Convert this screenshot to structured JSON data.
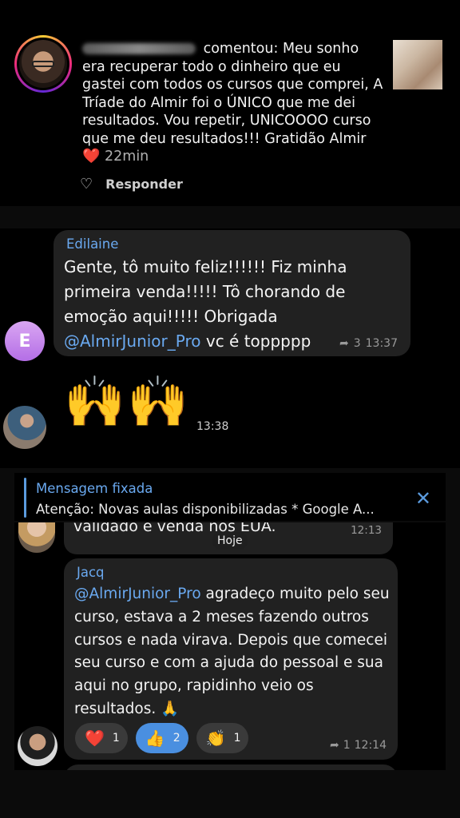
{
  "instagram": {
    "comment_prefix": "comentou:",
    "comment_text": "Meu sonho era recuperar todo o dinheiro que eu gastei com todos os cursos que comprei, A Tríade do Almir foi o ÚNICO que me dei resultados. Vou repetir, UNICOOOO curso que me deu resultados!!! Gratidão Almir",
    "heart_emoji": "❤️",
    "time": "22min",
    "reply_label": "Responder",
    "like_icon": "heart-outline-icon"
  },
  "chat1": {
    "sender": "Edilaine",
    "message_text": "Gente, tô muito feliz!!!!!! Fiz minha primeira venda!!!!! Tô chorando de emoção aqui!!!!! Obrigada ",
    "mention": "@AlmirJunior_Pro",
    "message_suffix": " vc é toppppp",
    "reply_count": "3",
    "time": "13:37",
    "avatar_letter": "E",
    "emoji_message": "🙌🙌",
    "emoji_time": "13:38"
  },
  "chat2": {
    "pinned_title": "Mensagem fixada",
    "pinned_text": "Atenção: Novas aulas disponibilizadas * Google A...",
    "close_icon": "✕",
    "prev_message": "validado e venda nos EUA.",
    "prev_time": "12:13",
    "date_chip": "Hoje",
    "sender": "Jacq",
    "mention": "@AlmirJunior_Pro",
    "message_text": " agradeço muito pelo seu curso, estava a 2 meses fazendo outros cursos e nada virava. Depois que comecei seu curso e com a ajuda do pessoal e sua aqui no grupo, rapidinho veio os resultados. 🙏",
    "reactions": [
      {
        "emoji": "❤️",
        "count": "1"
      },
      {
        "emoji": "👍",
        "count": "2"
      },
      {
        "emoji": "👏",
        "count": "1"
      }
    ],
    "reply_count": "1",
    "time": "12:14"
  },
  "colors": {
    "link_blue": "#6aa9f0",
    "bubble_bg": "#212121",
    "active_reaction": "#4a8fe0"
  }
}
